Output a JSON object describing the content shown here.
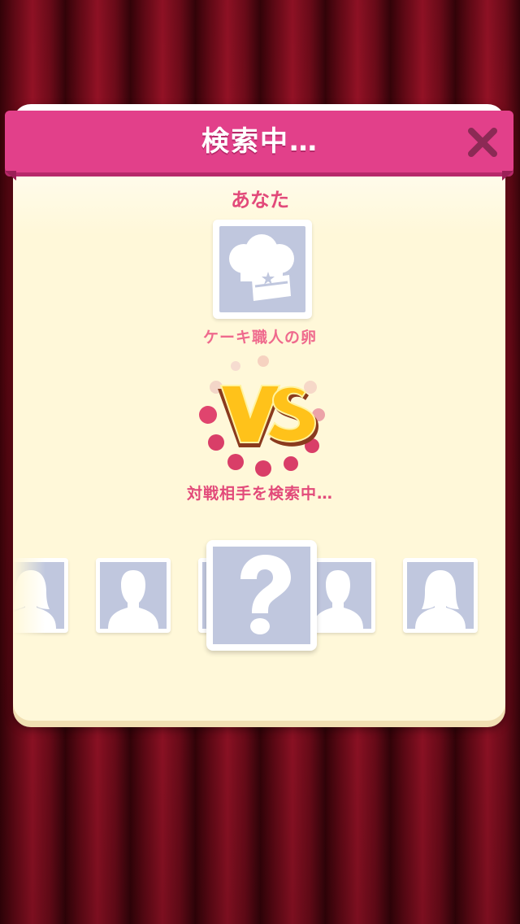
{
  "dialog": {
    "title": "検索中…",
    "close_icon": "close-x-icon"
  },
  "player": {
    "label": "あなた",
    "avatar_icon": "chef-hat-icon",
    "rank": "ケーキ職人の卵"
  },
  "versus": {
    "badge_text": "VS",
    "status": "対戦相手を検索中…"
  },
  "opponents": {
    "slots": [
      {
        "icon": "female-silhouette-icon"
      },
      {
        "icon": "male-silhouette-icon"
      },
      {
        "icon": "question-mark-icon"
      },
      {
        "icon": "male-silhouette-icon"
      },
      {
        "icon": "female-silhouette-icon"
      }
    ]
  },
  "colors": {
    "ribbon": "#e2408a",
    "panel": "#fff8d9",
    "accent_text": "#e24a7a",
    "placeholder": "#c0c7de",
    "close_x": "#8c2a55"
  }
}
